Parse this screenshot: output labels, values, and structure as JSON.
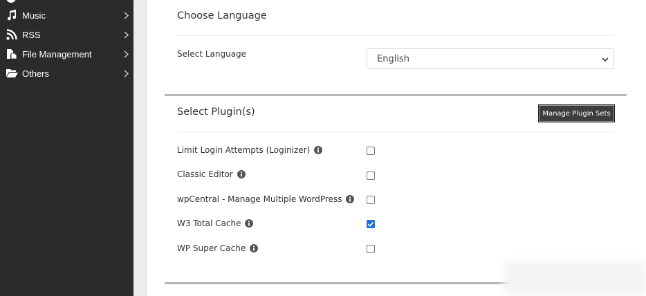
{
  "sidebar": {
    "items": [
      {
        "label": "Music",
        "icon": "music-note-icon"
      },
      {
        "label": "RSS",
        "icon": "rss-icon"
      },
      {
        "label": "File Management",
        "icon": "file-management-icon"
      },
      {
        "label": "Others",
        "icon": "folder-open-icon"
      }
    ]
  },
  "language_section": {
    "heading": "Choose Language",
    "label": "Select Language",
    "selected": "English"
  },
  "plugin_section": {
    "heading": "Select Plugin(s)",
    "manage_button": "Manage Plugin Sets",
    "plugins": [
      {
        "label": "Limit Login Attempts (Loginizer)",
        "checked": false
      },
      {
        "label": "Classic Editor",
        "checked": false
      },
      {
        "label": "wpCentral - Manage Multiple WordPress",
        "checked": false
      },
      {
        "label": "W3 Total Cache",
        "checked": true
      },
      {
        "label": "WP Super Cache",
        "checked": false
      }
    ]
  },
  "colors": {
    "sidebar_bg": "#2b2b2b",
    "checkbox_checked": "#1f6fd1"
  }
}
